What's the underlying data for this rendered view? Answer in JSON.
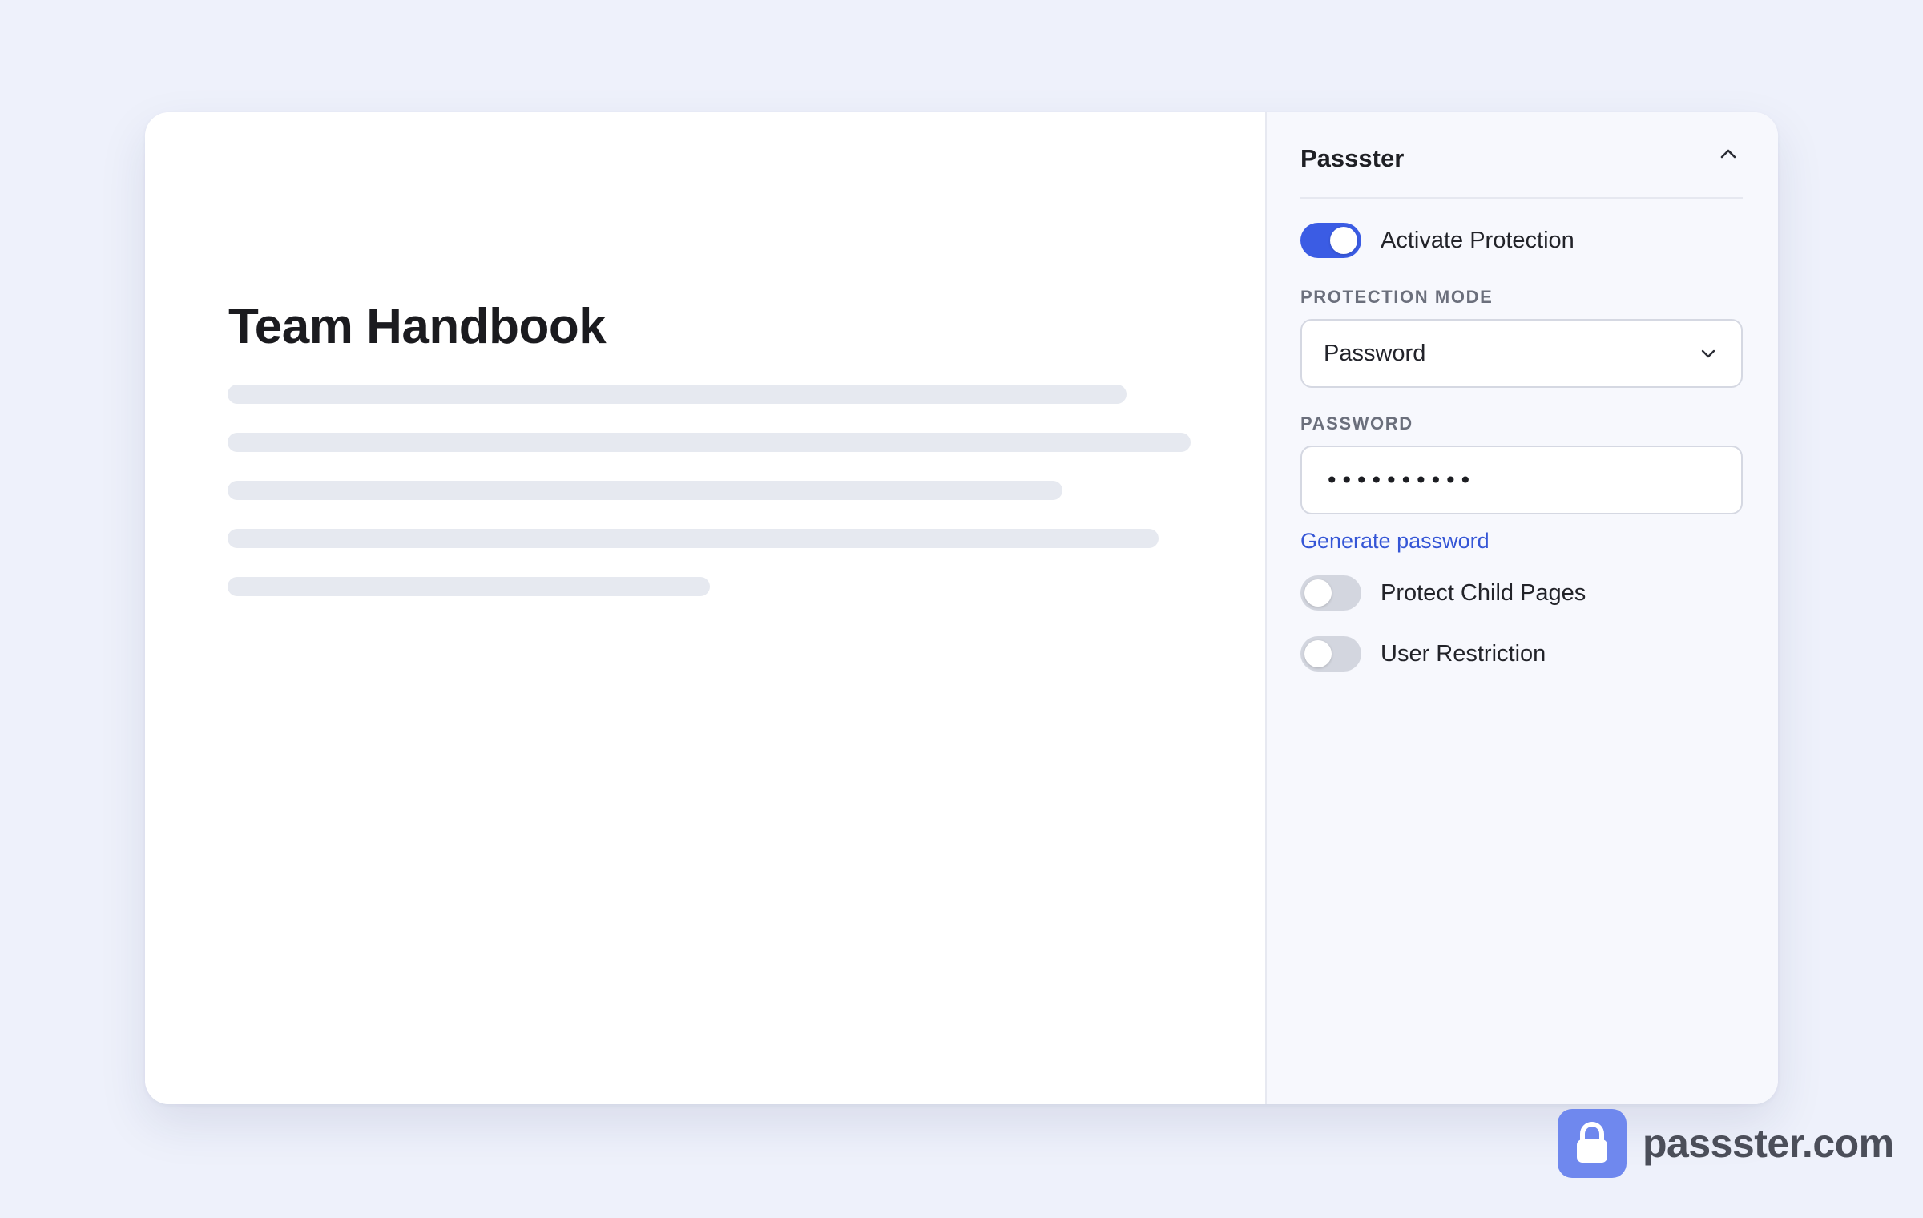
{
  "editor": {
    "title": "Team Handbook"
  },
  "panel": {
    "title": "Passster",
    "activate_protection": {
      "label": "Activate Protection",
      "enabled": true
    },
    "protection_mode": {
      "label": "PROTECTION MODE",
      "selected": "Password"
    },
    "password": {
      "label": "PASSWORD",
      "value": "••••••••••",
      "generate_link": "Generate password"
    },
    "protect_child_pages": {
      "label": "Protect Child Pages",
      "enabled": false
    },
    "user_restriction": {
      "label": "User Restriction",
      "enabled": false
    }
  },
  "brand": {
    "text": "passster.com"
  },
  "colors": {
    "accent": "#3b5ce4",
    "link": "#3556d6",
    "brand_badge": "#6f88ee",
    "background": "#eef1fb"
  },
  "icons": {
    "collapse": "chevron-up-icon",
    "select": "chevron-down-icon",
    "brand": "lock-icon"
  }
}
